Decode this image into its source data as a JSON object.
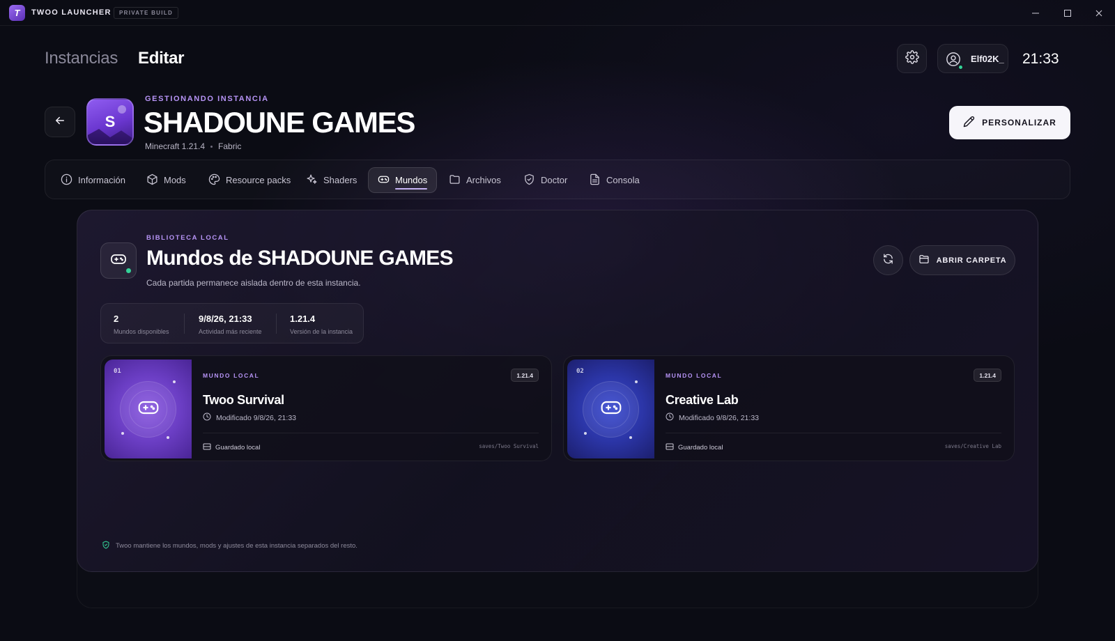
{
  "window": {
    "app_name": "TWOO LAUNCHER",
    "logo_letter": "T",
    "build_badge": "PRIVATE BUILD"
  },
  "header": {
    "breadcrumb_inactive": "Instancias",
    "breadcrumb_active": "Editar",
    "user_name": "Elf02K_",
    "clock": "21:33"
  },
  "instance": {
    "overline": "GESTIONANDO INSTANCIA",
    "icon_letter": "S",
    "name": "SHADOUNE GAMES",
    "version": "Minecraft 1.21.4",
    "loader": "Fabric",
    "customize_label": "PERSONALIZAR"
  },
  "tabs": [
    {
      "label": "Información",
      "icon": "info-icon",
      "active": false
    },
    {
      "label": "Mods",
      "icon": "cube-icon",
      "active": false
    },
    {
      "label": "Resource packs",
      "icon": "palette-icon",
      "active": false
    },
    {
      "label": "Shaders",
      "icon": "sparkles-icon",
      "active": false
    },
    {
      "label": "Mundos",
      "icon": "gamepad-icon",
      "active": true
    },
    {
      "label": "Archivos",
      "icon": "folder-icon",
      "active": false
    },
    {
      "label": "Doctor",
      "icon": "shield-icon",
      "active": false
    },
    {
      "label": "Consola",
      "icon": "document-icon",
      "active": false
    }
  ],
  "worlds": {
    "overline": "BIBLIOTECA LOCAL",
    "title": "Mundos de SHADOUNE GAMES",
    "subtitle": "Cada partida permanece aislada dentro de esta instancia.",
    "open_folder_label": "ABRIR CARPETA",
    "stats": [
      {
        "value": "2",
        "label": "Mundos disponibles"
      },
      {
        "value": "9/8/26, 21:33",
        "label": "Actividad más reciente"
      },
      {
        "value": "1.21.4",
        "label": "Versión de la instancia"
      }
    ],
    "cards": [
      {
        "number": "01",
        "overline": "MUNDO LOCAL",
        "name": "Twoo Survival",
        "modified": "Modificado 9/8/26, 21:33",
        "version": "1.21.4",
        "storage": "Guardado local",
        "path": "saves/Twoo Survival",
        "theme": "purple"
      },
      {
        "number": "02",
        "overline": "MUNDO LOCAL",
        "name": "Creative Lab",
        "modified": "Modificado 9/8/26, 21:33",
        "version": "1.21.4",
        "storage": "Guardado local",
        "path": "saves/Creative Lab",
        "theme": "blue"
      }
    ],
    "footer_note": "Twoo mantiene los mundos, mods y ajustes de esta instancia separados del resto."
  },
  "colors": {
    "background": "#0b0c14",
    "accent": "#b794f6",
    "online": "#34d399",
    "card_purple": "#7a48d6",
    "card_blue": "#2e3aa8"
  }
}
